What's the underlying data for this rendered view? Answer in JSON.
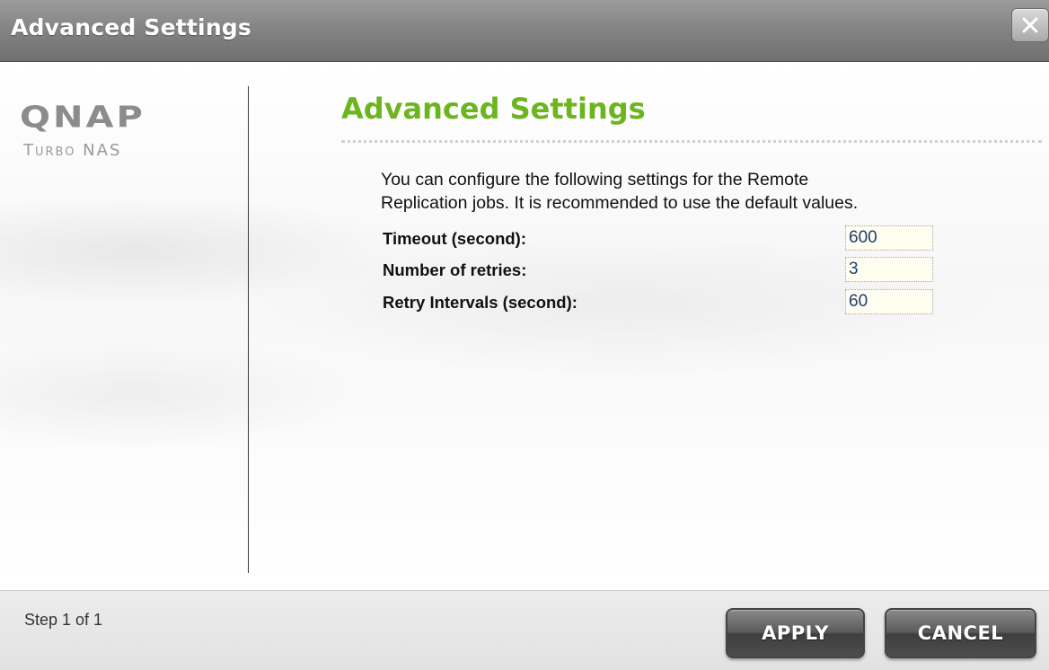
{
  "window": {
    "title": "Advanced Settings",
    "close_label": "X"
  },
  "brand": {
    "logo_main": "QNAP",
    "logo_sub": "Turbo NAS"
  },
  "main": {
    "heading": "Advanced Settings",
    "description_line1": "You can configure the following settings for the Remote",
    "description_line2": "Replication jobs. It is recommended to use the default values.",
    "fields": [
      {
        "label": "Timeout (second):",
        "value": "600"
      },
      {
        "label": "Number of retries:",
        "value": "3"
      },
      {
        "label": "Retry Intervals (second):",
        "value": "60"
      }
    ]
  },
  "footer": {
    "step": "Step 1 of 1",
    "apply_label": "APPLY",
    "cancel_label": "CANCEL"
  },
  "colors": {
    "heading_green": "#6cb51f",
    "input_text": "#1f3e6e",
    "title_bar": "#858585"
  }
}
